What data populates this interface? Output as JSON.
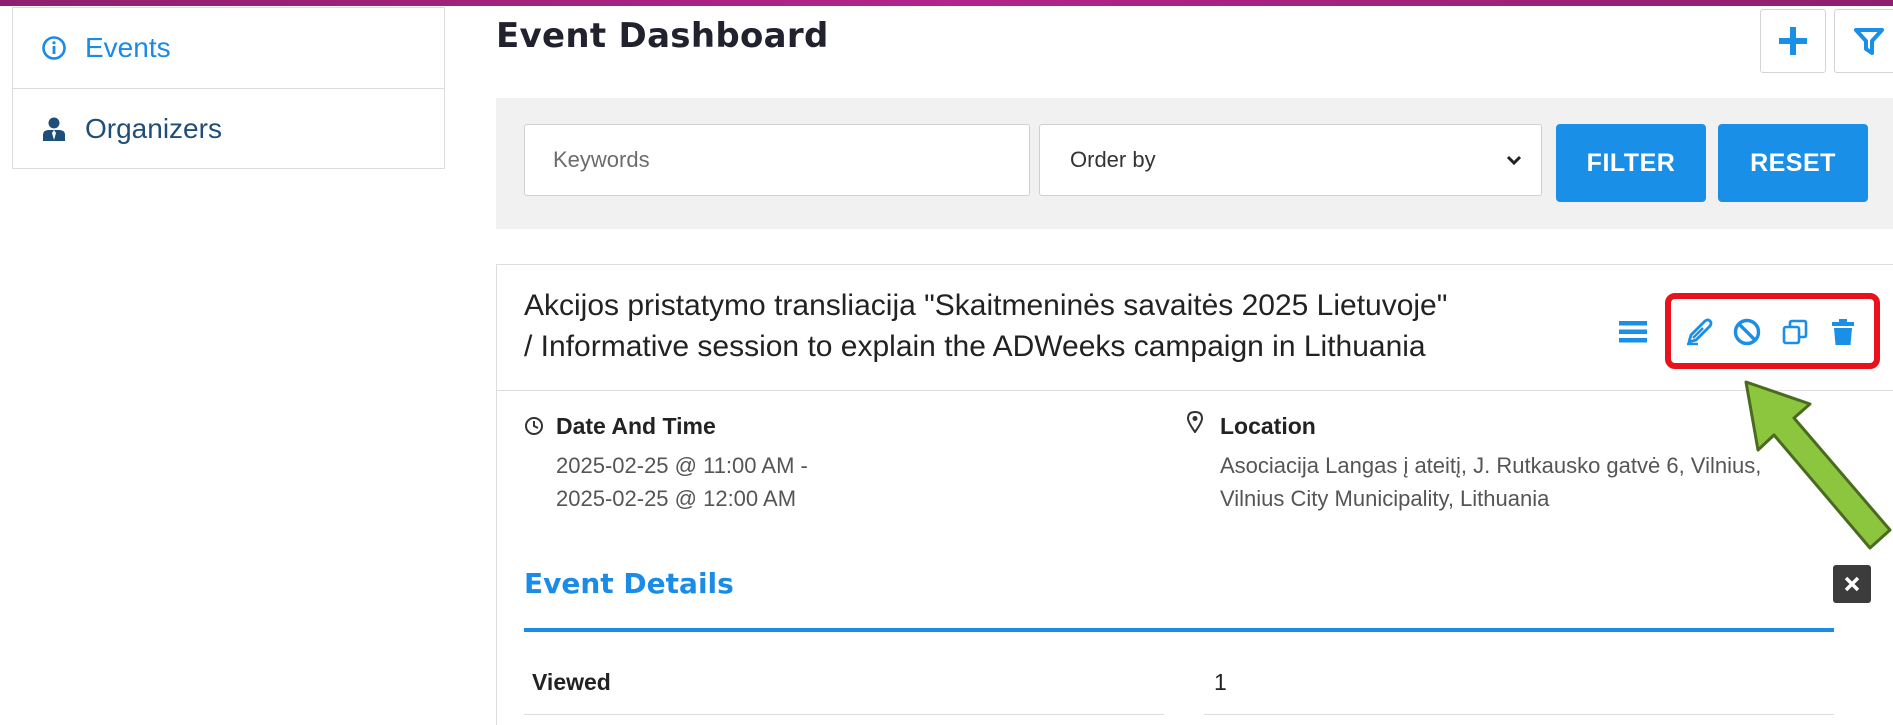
{
  "sidebar": {
    "items": [
      {
        "label": "Events",
        "icon": "info-circle-icon",
        "active": true
      },
      {
        "label": "Organizers",
        "icon": "user-tie-icon",
        "active": false
      }
    ]
  },
  "header": {
    "title": "Event Dashboard",
    "add_icon": "plus-icon",
    "filter_icon": "funnel-icon"
  },
  "filters": {
    "keywords_placeholder": "Keywords",
    "keywords_value": "",
    "order_by_selected": "Order by",
    "filter_label": "FILTER",
    "reset_label": "RESET"
  },
  "event": {
    "title_line1": "Akcijos pristatymo transliacija \"Skaitmeninės savaitės 2025 Lietuvoje\"",
    "title_line2": "/ Informative session to explain the ADWeeks campaign in Lithuania",
    "actions": [
      "menu-icon",
      "edit-icon",
      "cancel-icon",
      "copy-icon",
      "trash-icon"
    ],
    "date_label": "Date And Time",
    "date_line1": "2025-02-25 @ 11:00 AM -",
    "date_line2": "2025-02-25 @ 12:00 AM",
    "location_label": "Location",
    "location_line1": "Asociacija Langas į ateitį, J. Rutkausko gatvė 6, Vilnius,",
    "location_line2": "Vilnius City Municipality, Lithuania",
    "details_title": "Event Details",
    "details_rows": [
      {
        "label": "Viewed",
        "value": "1"
      }
    ]
  },
  "colors": {
    "accent": "#1a8fe8",
    "highlight_box": "#e8121c",
    "annotation_arrow": "#8cc63f",
    "top_bar": "#b3248c"
  }
}
